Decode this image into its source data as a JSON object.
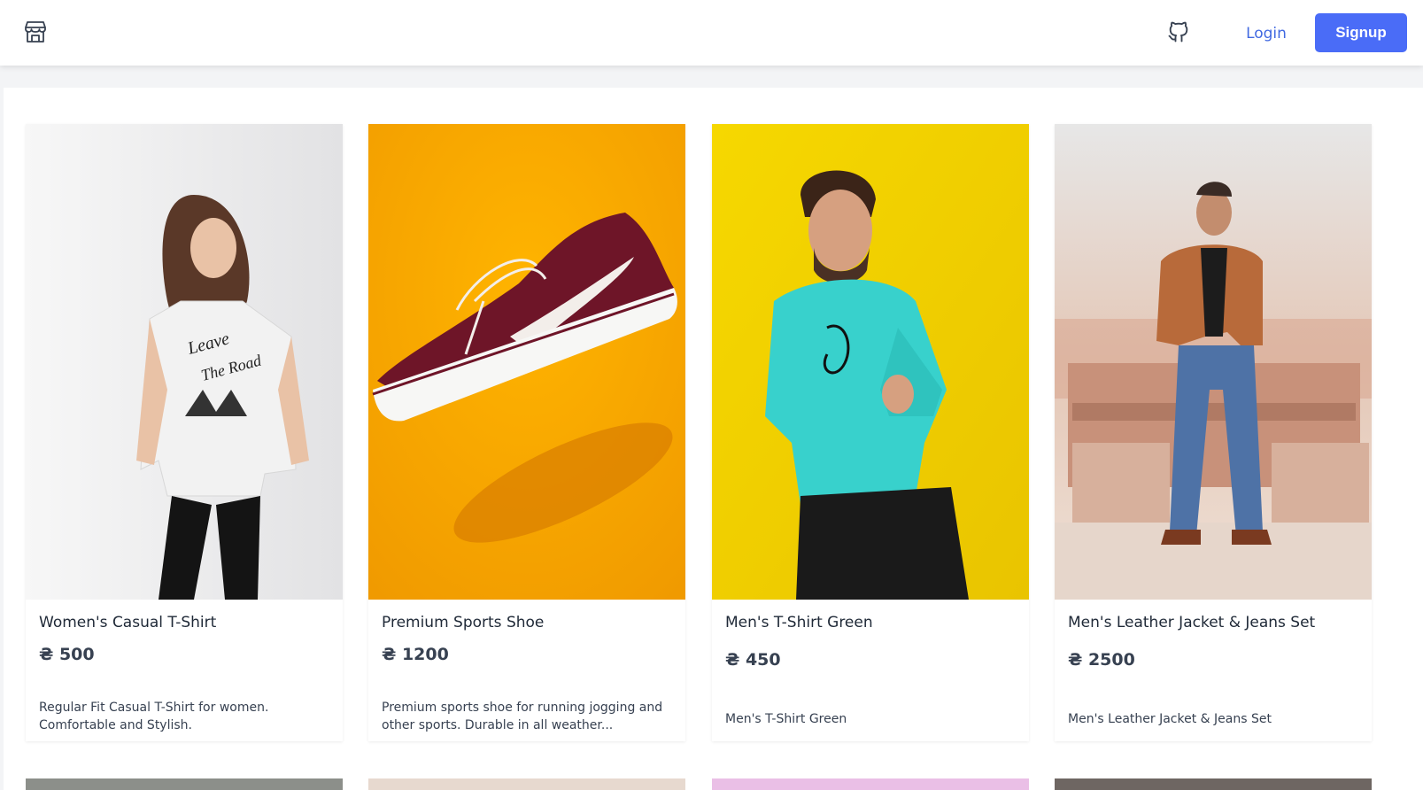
{
  "nav": {
    "logo_icon": "store-icon",
    "github_icon": "github-icon",
    "login_label": "Login",
    "signup_label": "Signup",
    "accent_color": "#4a6cf7"
  },
  "products": [
    {
      "title": "Women's Casual T-Shirt",
      "price": "₴ 500",
      "description": "Regular Fit Casual T-Shirt for women. Comfortable and Stylish."
    },
    {
      "title": "Premium Sports Shoe",
      "price": "₴ 1200",
      "description": "Premium sports shoe for running jogging and other sports. Durable in all weather..."
    },
    {
      "title": "Men's T-Shirt Green",
      "price": "₴ 450",
      "description": "Men's T-Shirt Green"
    },
    {
      "title": "Men's Leather Jacket & Jeans Set",
      "price": "₴ 2500",
      "description": "Men's Leather Jacket & Jeans Set"
    }
  ]
}
